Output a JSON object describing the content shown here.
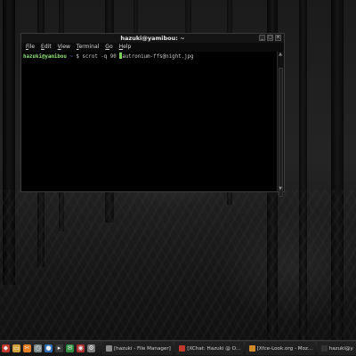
{
  "terminal": {
    "title": "hazuki@yamibou: ~",
    "menu": [
      "File",
      "Edit",
      "View",
      "Terminal",
      "Go",
      "Help"
    ],
    "prompt_user": "hazuki@yamibou",
    "prompt_path": "~",
    "command": "$ scrot -q 90",
    "command_tail": "autronium-ffs@night.jpg"
  },
  "taskbar": {
    "launchers": [
      {
        "icon": "app-menu-icon",
        "color": "#c0392b"
      },
      {
        "icon": "folder-icon",
        "color": "#d4a23c"
      },
      {
        "icon": "tools-icon",
        "color": "#e67e22"
      },
      {
        "icon": "clock-icon",
        "color": "#7f8c8d"
      },
      {
        "icon": "firefox-icon",
        "color": "#2e6fb8"
      },
      {
        "icon": "terminal-icon",
        "color": "#3a3a3a"
      },
      {
        "icon": "chat-icon",
        "color": "#2d8a3e"
      },
      {
        "icon": "media-icon",
        "color": "#b03030"
      },
      {
        "icon": "settings-icon",
        "color": "#7a7a7a"
      }
    ],
    "tasks": [
      {
        "label": "[hazuki - File Manager]",
        "color": "#8a8a8a"
      },
      {
        "label": "[XChat: Hazuki @ O...",
        "color": "#c0392b"
      },
      {
        "label": "[Xfce-Look.org - Moz...",
        "color": "#d08a2a"
      },
      {
        "label": "hazuki@y",
        "color": "#333333"
      }
    ]
  }
}
